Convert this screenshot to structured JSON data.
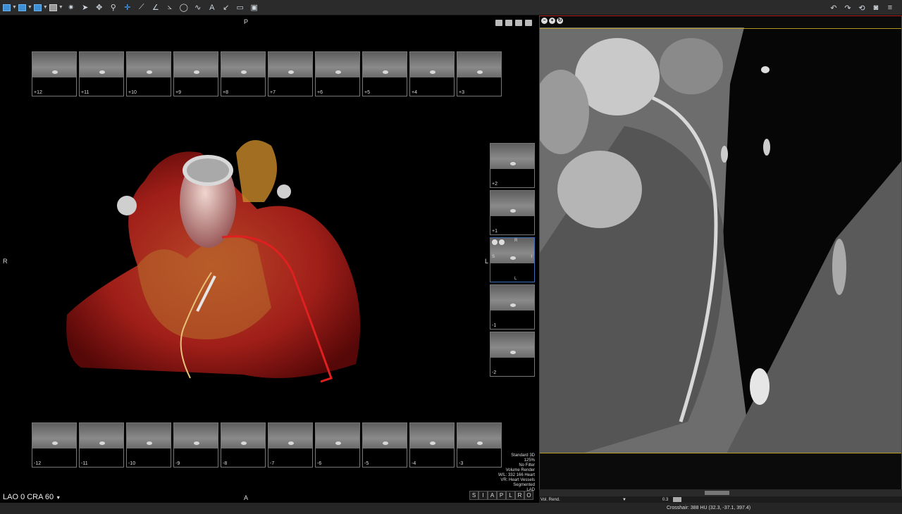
{
  "toolbar": {
    "left_tools": [
      "layout-grid-icon",
      "layout-list-icon",
      "layout-split-icon",
      "layout-single-icon",
      "brightness-icon",
      "pointer-icon",
      "pan-icon",
      "zoom-icon",
      "crosshair-icon",
      "ruler-icon",
      "angle-icon",
      "cobb-angle-icon",
      "ellipse-icon",
      "curve-icon",
      "text-icon",
      "arrow-icon",
      "roi-icon",
      "snapshot-icon"
    ],
    "right_tools": [
      "undo-icon",
      "redo-icon",
      "reset-icon",
      "camera-icon",
      "menu-icon"
    ]
  },
  "left_view": {
    "orientation": {
      "top": "P",
      "bottom": "A",
      "left": "R",
      "right": "L"
    },
    "top_thumbs": [
      "+12",
      "+11",
      "+10",
      "+9",
      "+8",
      "+7",
      "+6",
      "+5",
      "+4",
      "+3"
    ],
    "side_thumbs": [
      "+2",
      "+1",
      "",
      "-1",
      "-2"
    ],
    "center_thumb": {
      "top": "R",
      "left": "S",
      "right": "I",
      "bottom": "L"
    },
    "bottom_thumbs": [
      "-12",
      "-11",
      "-10",
      "-9",
      "-8",
      "-7",
      "-6",
      "-5",
      "-4",
      "-3"
    ],
    "info_lines": [
      "Standard 3D",
      "125%",
      "No Filter",
      "Volume Render",
      "W/L: 332 166 Heart",
      "VR: Heart Vessels",
      "Segmented",
      "LAD"
    ],
    "angle_label": "LAO 0  CRA 60",
    "orient_buttons": [
      "S",
      "I",
      "A",
      "P",
      "L",
      "R",
      "O"
    ]
  },
  "right_view": {
    "bottom_label": "Vol. Rend.",
    "slider_value": "0.3"
  },
  "status": {
    "crosshair": "Crosshair: 388 HU (32.3, -37.1, 397.4)"
  },
  "colors": {
    "accent": "#3d8fd6",
    "frame": "#b21d1d",
    "line": "#b59a25"
  }
}
